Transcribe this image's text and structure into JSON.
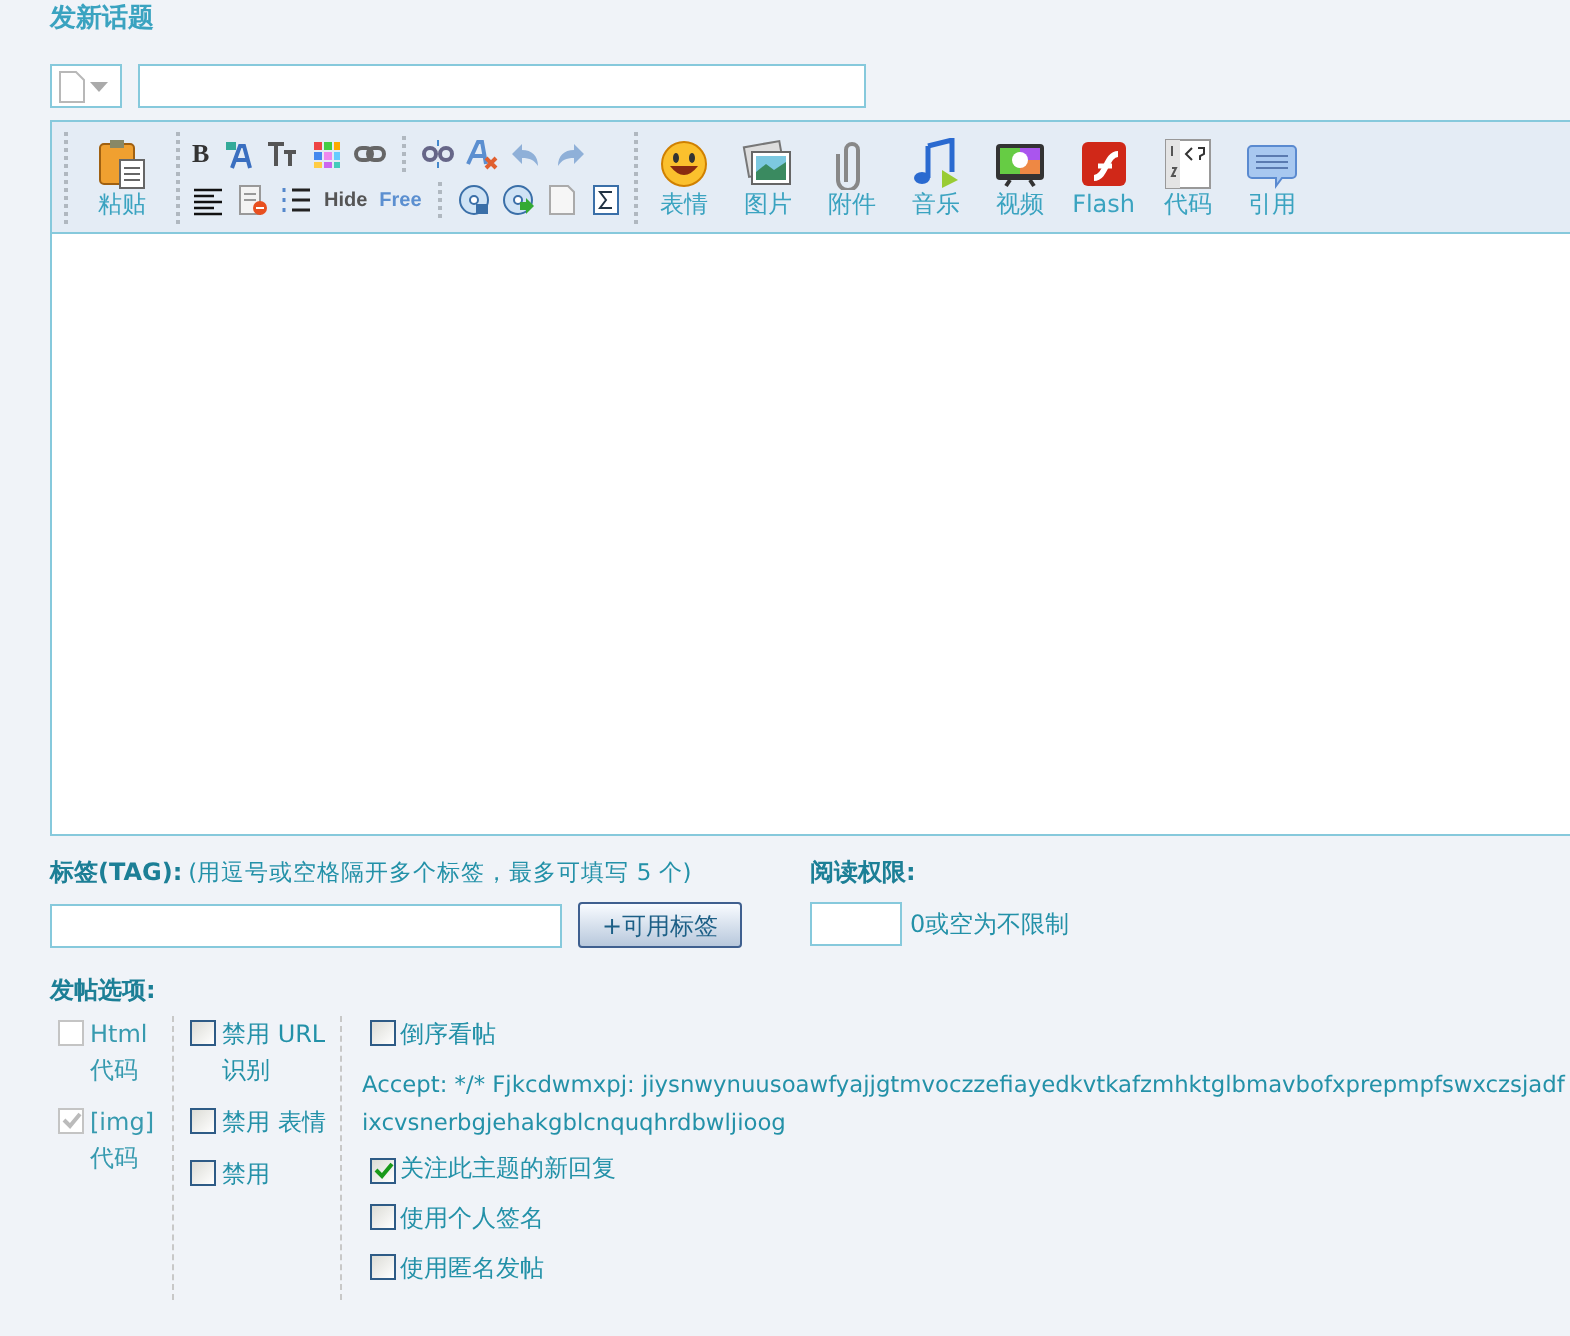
{
  "page_title": "发新话题",
  "toolbar": {
    "paste_label": "粘贴",
    "row_one": [
      {
        "kind": "bold",
        "text": "B"
      },
      {
        "kind": "font"
      },
      {
        "kind": "size"
      },
      {
        "kind": "color"
      },
      {
        "kind": "link"
      },
      {
        "kind": "sep"
      },
      {
        "kind": "unlink"
      },
      {
        "kind": "clear"
      },
      {
        "kind": "undo"
      },
      {
        "kind": "redo"
      }
    ],
    "row_two": [
      {
        "kind": "align"
      },
      {
        "kind": "removeformat"
      },
      {
        "kind": "list"
      },
      {
        "kind": "hide",
        "text": "Hide"
      },
      {
        "kind": "free",
        "text": "Free"
      },
      {
        "kind": "sep"
      },
      {
        "kind": "disc"
      },
      {
        "kind": "discgo"
      },
      {
        "kind": "page"
      },
      {
        "kind": "sigma"
      }
    ],
    "big": [
      {
        "kind": "smiley",
        "label": "表情"
      },
      {
        "kind": "picture",
        "label": "图片"
      },
      {
        "kind": "clip",
        "label": "附件"
      },
      {
        "kind": "music",
        "label": "音乐"
      },
      {
        "kind": "tv",
        "label": "视频"
      },
      {
        "kind": "flash",
        "label": "Flash"
      },
      {
        "kind": "code",
        "label": "代码"
      },
      {
        "kind": "quote",
        "label": "引用"
      }
    ]
  },
  "tags": {
    "label": "标签(TAG):",
    "hint": "(用逗号或空格隔开多个标签，最多可填写 5 个)",
    "button": "+可用标签"
  },
  "read_permission": {
    "label": "阅读权限:",
    "hint": "0或空为不限制"
  },
  "options": {
    "label": "发帖选项:",
    "column_1": [
      {
        "label": "Html 代码",
        "checked": false,
        "disabled": true
      },
      {
        "label": "[img] 代码",
        "checked": true,
        "disabled": true
      }
    ],
    "column_2": [
      {
        "label": "禁用 URL 识别",
        "checked": false,
        "disabled": false
      },
      {
        "label": "禁用 表情",
        "checked": false,
        "disabled": false
      },
      {
        "label": "禁用",
        "checked": false,
        "disabled": false
      }
    ],
    "column_3": [
      {
        "kind": "checkbox",
        "label": "倒序看帖",
        "checked": false
      },
      {
        "kind": "note",
        "label": "Accept: */* Fjkcdwmxpj: jiysnwynuusoawfyajjgtmvoczzefiayedkvtkafzmhktglbmavbofxprepmpfswxczsjadfixcvsnerbgjehakgblcnquqhrdbwljioog"
      },
      {
        "kind": "checkbox",
        "label": "关注此主题的新回复",
        "checked": true
      },
      {
        "kind": "checkbox",
        "label": "使用个人签名",
        "checked": false
      },
      {
        "kind": "checkbox",
        "label": "使用匿名发帖",
        "checked": false
      }
    ]
  }
}
